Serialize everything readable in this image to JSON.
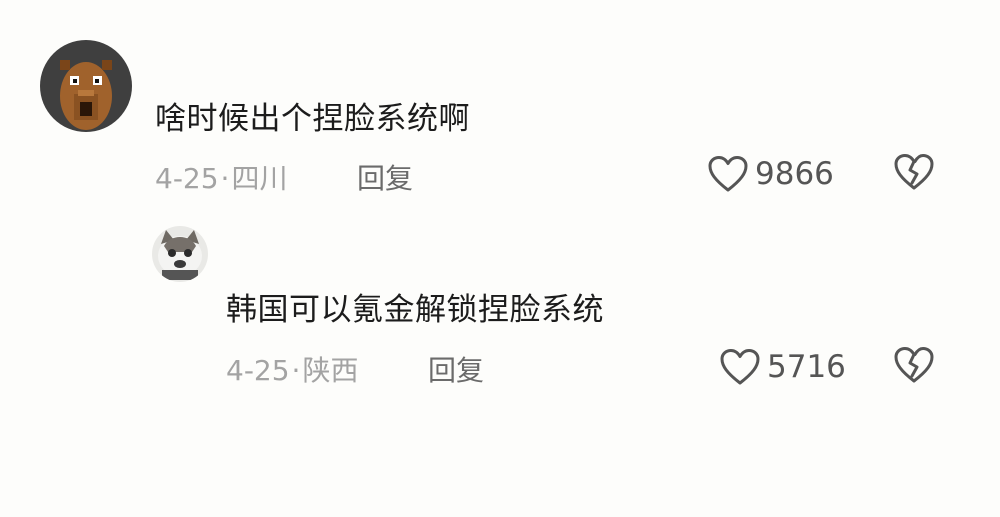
{
  "comments": [
    {
      "text": "啥时候出个捏脸系统啊",
      "date": "4-25",
      "separator": "·",
      "location": "四川",
      "reply_label": "回复",
      "like_count": "9866",
      "avatar_icon": "capybara-avatar-icon"
    },
    {
      "text": "韩国可以氪金解锁捏脸系统",
      "date": "4-25",
      "separator": "·",
      "location": "陕西",
      "reply_label": "回复",
      "like_count": "5716",
      "avatar_icon": "cat-avatar-icon"
    }
  ],
  "colors": {
    "background": "#fdfdfb",
    "text": "#1c1c1c",
    "meta": "#a3a3a3",
    "icon": "#555555"
  }
}
